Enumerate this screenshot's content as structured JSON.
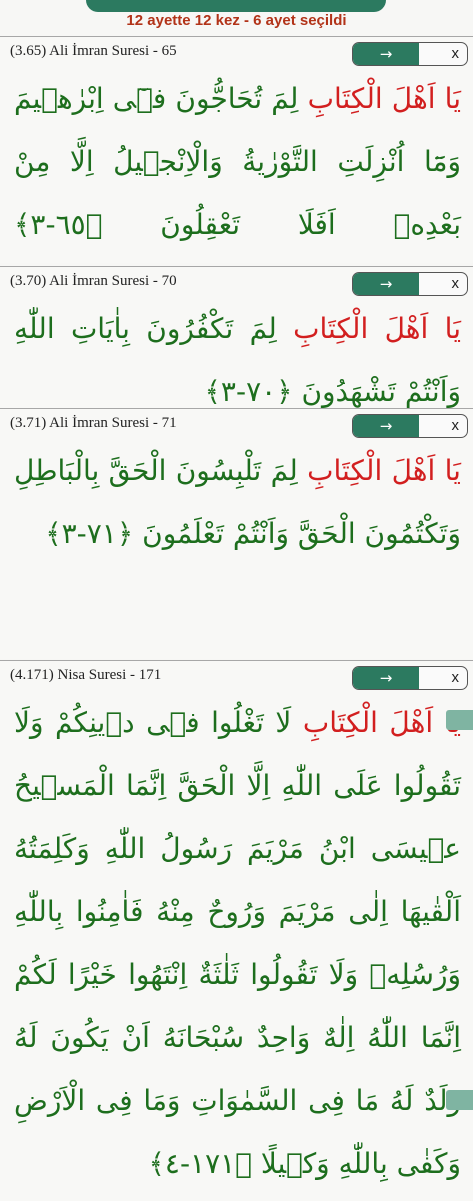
{
  "header": {
    "summary": "12 ayette 12 kez - 6 ayet seçildi"
  },
  "controls": {
    "go_label": "→",
    "close_label": "x"
  },
  "colors": {
    "accent": "#2c7a60",
    "search_term": "#d21f1f",
    "verse_text": "#1d6e1d",
    "summary_text": "#b23318"
  },
  "verses": [
    {
      "ref": "(3.65) Ali İmran Suresi - 65",
      "lead": "يَا اَهْلَ الْكِتَابِ",
      "text": " لِمَ تُحَاجُّونَ فٖٓى اِبْرٰهٖيمَ وَمَٓا اُنْزِلَتِ التَّوْرٰيةُ وَالْاِنْجٖيلُ اِلَّا مِنْ بَعْدِهٖ اَفَلَا تَعْقِلُونَ ",
      "marker": "﴿٦٥-٣﴾"
    },
    {
      "ref": "(3.70) Ali İmran Suresi - 70",
      "lead": "يَا اَهْلَ الْكِتَابِ",
      "text": " لِمَ تَكْفُرُونَ بِاٰيَاتِ اللّٰهِ وَاَنْتُمْ تَشْهَدُونَ ",
      "marker": "﴿٧٠-٣﴾"
    },
    {
      "ref": "(3.71) Ali İmran Suresi - 71",
      "lead": "يَا اَهْلَ الْكِتَابِ",
      "text": " لِمَ تَلْبِسُونَ الْحَقَّ بِالْبَاطِلِ وَتَكْتُمُونَ الْحَقَّ وَاَنْتُمْ تَعْلَمُونَ ",
      "marker": "﴿٧١-٣﴾"
    },
    {
      "ref": "(4.171) Nisa Suresi - 171",
      "lead": "يَٓا اَهْلَ الْكِتَابِ",
      "text": " لَا تَغْلُوا فٖى دٖينِكُمْ وَلَا تَقُولُوا عَلَى اللّٰهِ اِلَّا الْحَقَّ اِنَّمَا الْمَسٖيحُ عٖيسَى ابْنُ مَرْيَمَ رَسُولُ اللّٰهِ وَكَلِمَتُهُ اَلْقٰيهَا اِلٰى مَرْيَمَ وَرُوحٌ مِنْهُ فَاٰمِنُوا بِاللّٰهِ وَرُسُلِهٖ وَلَا تَقُولُوا ثَلٰثَةٌ اِنْتَهُوا خَيْرًا لَكُمْ اِنَّمَا اللّٰهُ اِلٰهٌ وَاحِدٌ سُبْحَانَهُ اَنْ يَكُونَ لَهُ وَلَدٌ لَهُ مَا فِى السَّمٰوَاتِ وَمَا فِى الْاَرْضِ وَكَفٰى بِاللّٰهِ وَكٖيلًا ",
      "marker": "﴿١٧١-٤﴾"
    }
  ]
}
